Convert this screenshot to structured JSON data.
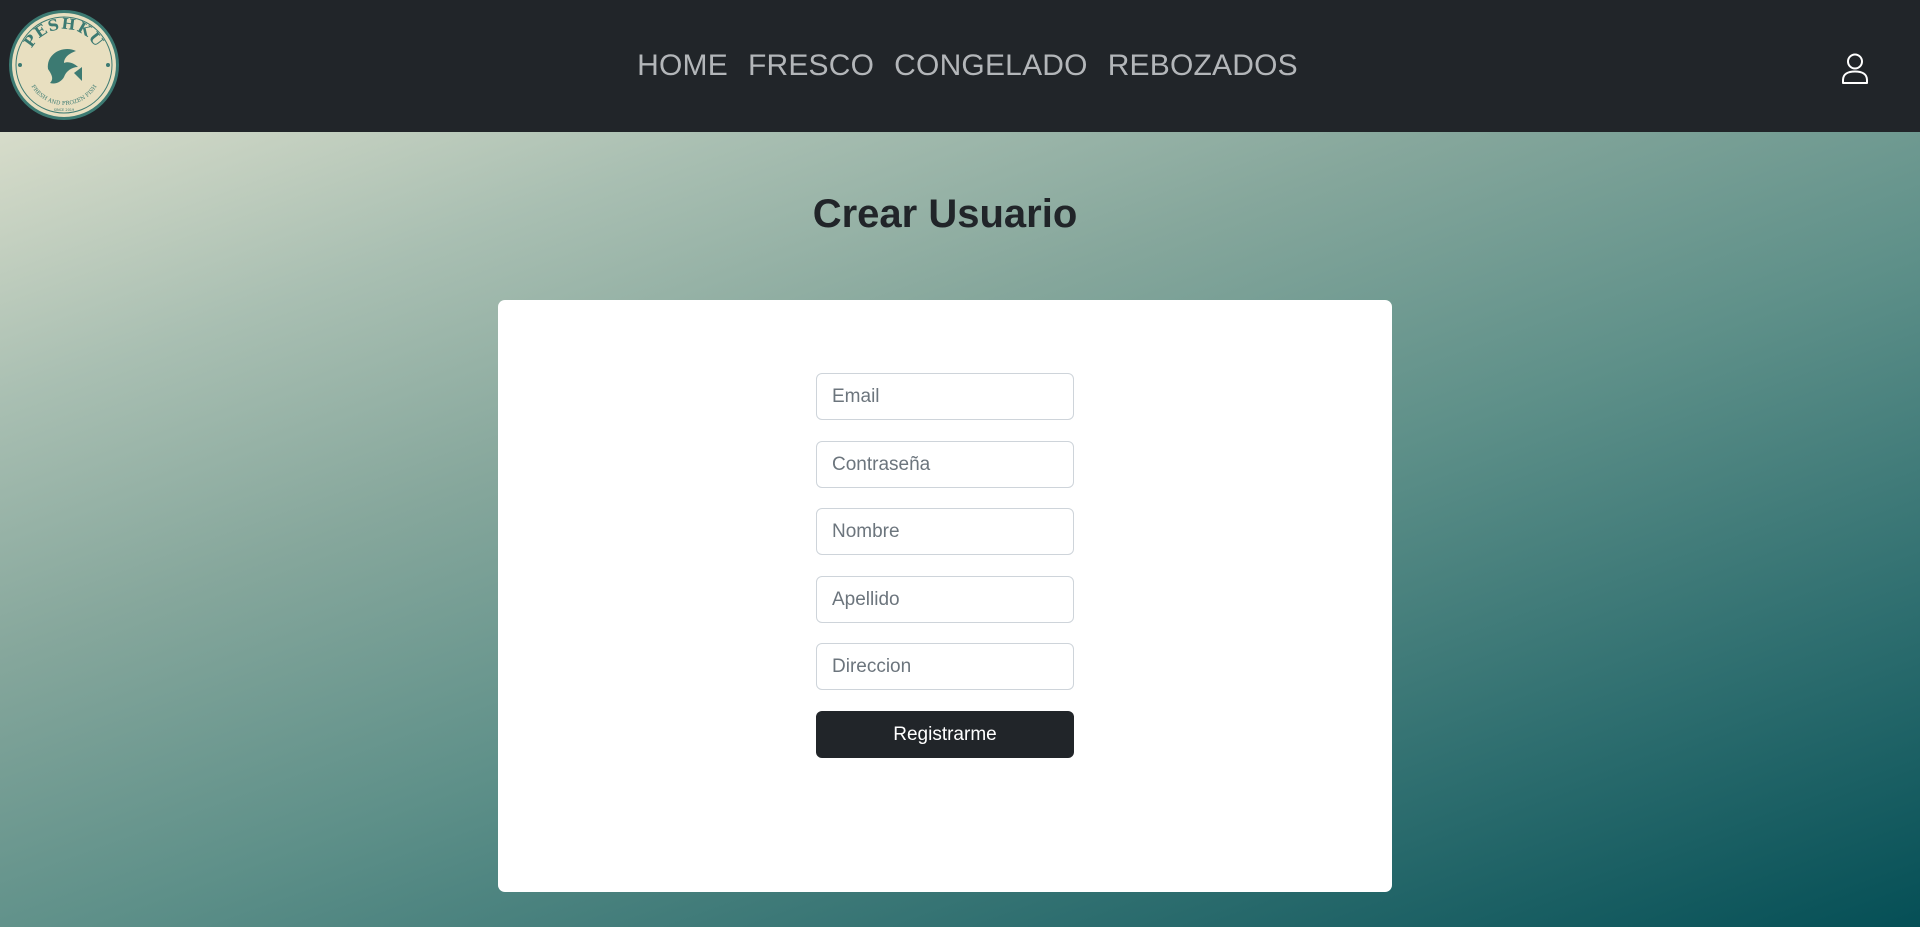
{
  "brand": {
    "logo_top_text": "PESHKU",
    "logo_ring_text": "FRESH AND FROZEN FISH",
    "logo_bottom_text": "SINCE 2019",
    "colors": {
      "navbar": "#212529",
      "logo_bg": "#e8dfc0",
      "logo_fg": "#3c7a72"
    }
  },
  "nav": {
    "items": [
      {
        "label": "HOME"
      },
      {
        "label": "FRESCO"
      },
      {
        "label": "CONGELADO"
      },
      {
        "label": "REBOZADOS"
      }
    ],
    "account_icon": "user-icon"
  },
  "main": {
    "title": "Crear Usuario",
    "form": {
      "fields": [
        {
          "placeholder": "Email",
          "value": ""
        },
        {
          "placeholder": "Contraseña",
          "value": ""
        },
        {
          "placeholder": "Nombre",
          "value": ""
        },
        {
          "placeholder": "Apellido",
          "value": ""
        },
        {
          "placeholder": "Direccion",
          "value": ""
        }
      ],
      "submit_label": "Registrarme"
    }
  }
}
